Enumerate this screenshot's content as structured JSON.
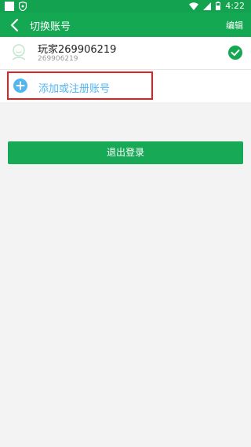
{
  "status_bar": {
    "time": "4:22"
  },
  "header": {
    "title": "切换账号",
    "edit_label": "编辑"
  },
  "account": {
    "name": "玩家269906219",
    "id": "269906219"
  },
  "add_account": {
    "label": "添加或注册账号"
  },
  "logout": {
    "label": "退出登录"
  },
  "colors": {
    "primary": "#15a853",
    "link": "#52b6f2",
    "highlight": "#e12020"
  }
}
